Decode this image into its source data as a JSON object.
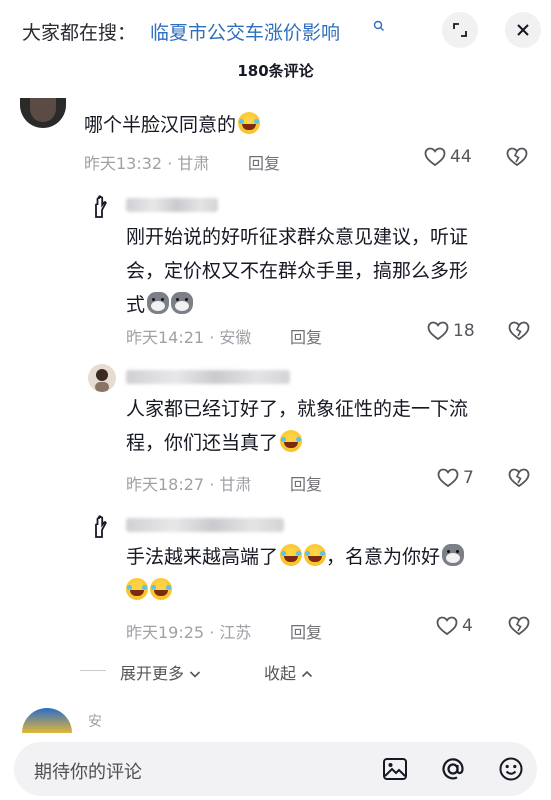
{
  "header": {
    "search_prefix": "大家都在搜：",
    "search_term": "临夏市公交车涨价影响",
    "comment_count_title": "180条评论"
  },
  "comments": [
    {
      "text": "哪个半脸汉同意的",
      "emoji": [
        "laugh-cry-emoji"
      ],
      "time_location": "昨天13:32 · 甘肃",
      "reply_label": "回复",
      "likes": "44"
    }
  ],
  "replies": [
    {
      "text_line1": "刚开始说的好听征求群众意见建议，听证",
      "text_line2": "会，定价权又不在群众手里，搞那么多形",
      "text_line3": "式",
      "time_location": "昨天14:21 · 安徽",
      "reply_label": "回复",
      "likes": "18"
    },
    {
      "text_line1": "人家都已经订好了，就象征性的走一下流",
      "text_line2": "程，你们还当真了",
      "time_location": "昨天18:27 · 甘肃",
      "reply_label": "回复",
      "likes": "7"
    },
    {
      "text_part1": "手法越来越高端了",
      "text_part2": "，名意为你好",
      "time_location": "昨天19:25 · 江苏",
      "reply_label": "回复",
      "likes": "4"
    }
  ],
  "thread_controls": {
    "expand_more": "展开更多",
    "collapse": "收起"
  },
  "next_comment": {
    "name_partial": "安"
  },
  "composer": {
    "placeholder": "期待你的评论"
  },
  "colors": {
    "link_blue": "#2f6fbd",
    "meta_gray": "#a0a1a6",
    "text_dark": "#161823"
  }
}
